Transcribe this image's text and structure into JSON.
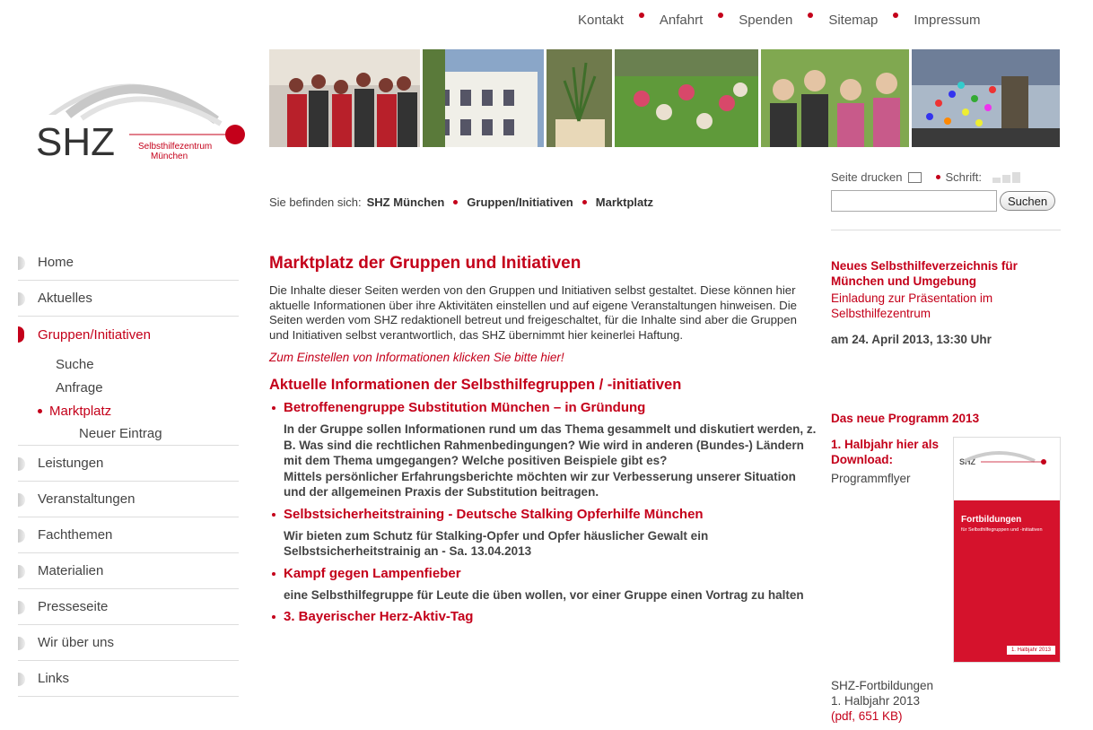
{
  "topnav": [
    "Kontakt",
    "Anfahrt",
    "Spenden",
    "Sitemap",
    "Impressum"
  ],
  "logo": {
    "short": "SHZ",
    "line1": "Selbsthilfezentrum",
    "line2": "München"
  },
  "tools": {
    "print": "Seite drucken",
    "font": "Schrift:",
    "search_button": "Suchen",
    "search_value": ""
  },
  "breadcrumb": {
    "prefix": "Sie befinden sich:",
    "items": [
      "SHZ München",
      "Gruppen/Initiativen",
      "Marktplatz"
    ]
  },
  "sidebar": {
    "items": [
      "Home",
      "Aktuelles",
      "Gruppen/Initiativen"
    ],
    "subitems": [
      "Suche",
      "Anfrage",
      "Marktplatz"
    ],
    "subsub": "Neuer Eintrag",
    "items2": [
      "Leistungen",
      "Veranstaltungen",
      "Fachthemen",
      "Materialien",
      "Presseseite",
      "Wir über uns",
      "Links"
    ]
  },
  "main": {
    "title": "Marktplatz der Gruppen und Initiativen",
    "intro": "Die Inhalte dieser Seiten werden von den Gruppen und Initiativen selbst gestaltet. Diese können hier aktuelle Informationen über ihre Aktivitäten einstellen und auf eigene Veranstaltungen hinweisen. Die Seiten werden vom SHZ redaktionell betreut und freigeschaltet, für die Inhalte sind aber die Gruppen und Initiativen selbst verantwortlich, das SHZ übernimmt hier keinerlei Haftung.",
    "cta": "Zum Einstellen von Informationen klicken Sie bitte hier!",
    "section_title": "Aktuelle Informationen der Selbsthilfegruppen / -initiativen",
    "entries": [
      {
        "title": "Betroffenengruppe Substitution München – in Gründung",
        "desc": "In der Gruppe sollen Informationen rund um das Thema gesammelt und diskutiert werden, z. B. Was sind die rechtlichen Rahmenbedingungen? Wie wird in anderen (Bundes-) Ländern mit dem Thema umgegangen? Welche positiven Beispiele gibt es?",
        "desc2": "Mittels persönlicher Erfahrungsberichte möchten wir zur Verbesserung unserer Situation und der allgemeinen Praxis der Substitution beitragen."
      },
      {
        "title": "Selbstsicherheitstraining - Deutsche Stalking Opferhilfe München",
        "desc": "Wir bieten zum Schutz für Stalking-Opfer und Opfer häuslicher Gewalt ein Selbstsicherheitstrainig an - Sa. 13.04.2013"
      },
      {
        "title": "Kampf gegen Lampenfieber",
        "desc": "eine Selbsthilfegruppe für Leute die üben wollen, vor einer Gruppe einen Vortrag zu halten"
      },
      {
        "title": "3. Bayerischer Herz-Aktiv-Tag"
      }
    ]
  },
  "right": {
    "news_title": "Neues Selbsthilfeverzeichnis für München und Umgebung",
    "news_sub": "Einladung zur Präsentation im Selbsthilfezentrum",
    "news_date": "am 24. April 2013, 13:30 Uhr",
    "prog_title": "Das neue Programm 2013",
    "download": "1. Halbjahr hier als Download:",
    "flyer": "Programmflyer",
    "cover_title": "Fortbildungen",
    "cover_sub": "für Selbsthilfegruppen und -initiativen",
    "cover_badge": "1. Halbjahr 2013",
    "cover_logo": "SHZ",
    "foot1": "SHZ-Fortbildungen",
    "foot2": "1. Halbjahr 2013",
    "foot3": "(pdf, 651 KB)"
  }
}
